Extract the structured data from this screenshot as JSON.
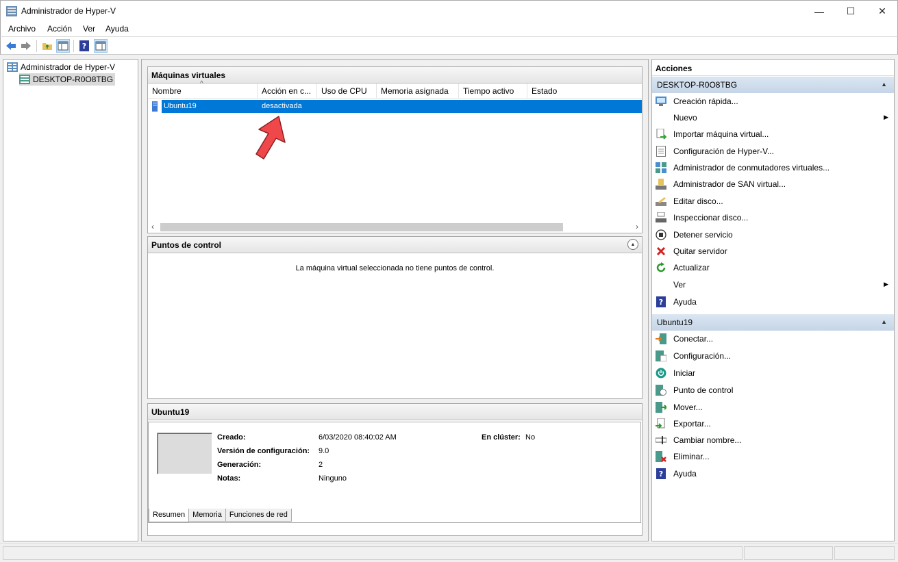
{
  "window": {
    "title": "Administrador de Hyper-V",
    "controls": {
      "minimize": "—",
      "maximize": "☐",
      "close": "✕"
    }
  },
  "menu": [
    "Archivo",
    "Acción",
    "Ver",
    "Ayuda"
  ],
  "tree": {
    "root": "Administrador de Hyper-V",
    "server": "DESKTOP-R0O8TBG"
  },
  "vms_panel": {
    "title": "Máquinas virtuales",
    "columns": [
      "Nombre",
      "Acción en c...",
      "Uso de CPU",
      "Memoria asignada",
      "Tiempo activo",
      "Estado"
    ],
    "rows": [
      {
        "name": "Ubuntu19",
        "state": "desactivada",
        "cpu": "",
        "memory": "",
        "uptime": "",
        "status": ""
      }
    ]
  },
  "checkpoints_panel": {
    "title": "Puntos de control",
    "empty_message": "La máquina virtual seleccionada no tiene puntos de control."
  },
  "details_panel": {
    "title": "Ubuntu19",
    "fields": [
      {
        "label": "Creado:",
        "value": "6/03/2020 08:40:02 AM"
      },
      {
        "label": "Versión de configuración:",
        "value": "9.0"
      },
      {
        "label": "Generación:",
        "value": "2"
      },
      {
        "label": "Notas:",
        "value": "Ninguno"
      }
    ],
    "cluster": {
      "label": "En clúster:",
      "value": "No"
    },
    "tabs": [
      "Resumen",
      "Memoria",
      "Funciones de red"
    ]
  },
  "actions_panel": {
    "title": "Acciones",
    "server_group": {
      "title": "DESKTOP-R0O8TBG",
      "items": [
        {
          "label": "Creación rápida...",
          "icon": "quick-create-icon"
        },
        {
          "label": "Nuevo",
          "icon": "",
          "submenu": true
        },
        {
          "label": "Importar máquina virtual...",
          "icon": "import-icon"
        },
        {
          "label": "Configuración de Hyper-V...",
          "icon": "settings-page-icon"
        },
        {
          "label": "Administrador de conmutadores virtuales...",
          "icon": "switch-manager-icon"
        },
        {
          "label": "Administrador de SAN virtual...",
          "icon": "san-manager-icon"
        },
        {
          "label": "Editar disco...",
          "icon": "edit-disk-icon"
        },
        {
          "label": "Inspeccionar disco...",
          "icon": "inspect-disk-icon"
        },
        {
          "label": "Detener servicio",
          "icon": "stop-icon"
        },
        {
          "label": "Quitar servidor",
          "icon": "remove-x-icon"
        },
        {
          "label": "Actualizar",
          "icon": "refresh-icon"
        },
        {
          "label": "Ver",
          "icon": "",
          "submenu": true
        },
        {
          "label": "Ayuda",
          "icon": "help-icon"
        }
      ]
    },
    "vm_group": {
      "title": "Ubuntu19",
      "items": [
        {
          "label": "Conectar...",
          "icon": "connect-icon"
        },
        {
          "label": "Configuración...",
          "icon": "vm-settings-icon"
        },
        {
          "label": "Iniciar",
          "icon": "power-icon"
        },
        {
          "label": "Punto de control",
          "icon": "checkpoint-icon"
        },
        {
          "label": "Mover...",
          "icon": "move-icon"
        },
        {
          "label": "Exportar...",
          "icon": "export-icon"
        },
        {
          "label": "Cambiar nombre...",
          "icon": "rename-icon"
        },
        {
          "label": "Eliminar...",
          "icon": "delete-icon"
        },
        {
          "label": "Ayuda",
          "icon": "help-icon"
        }
      ]
    }
  },
  "colors": {
    "selection": "#0078d7",
    "group_header": "#c5d5e7",
    "arrow_annotation": "#f0474a"
  }
}
